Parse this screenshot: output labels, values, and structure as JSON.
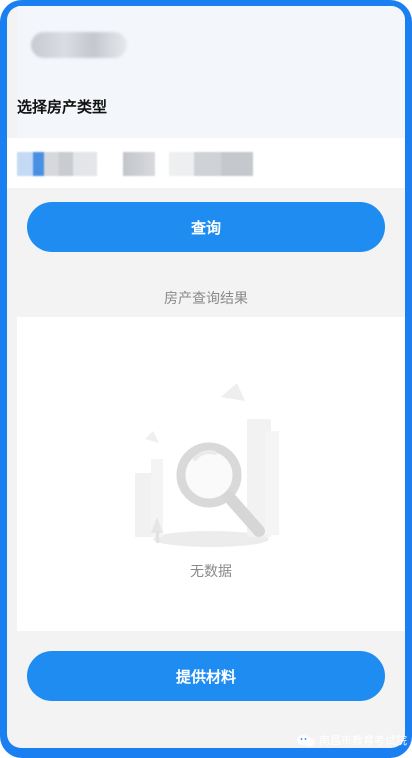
{
  "form": {
    "label": "选择房产类型"
  },
  "buttons": {
    "search": "查询",
    "submit": "提供材料"
  },
  "results": {
    "title": "房产查询结果",
    "empty_text": "无数据"
  },
  "watermark": {
    "text": "南昌市教育考试院",
    "icon": "wechat-icon"
  },
  "colors": {
    "accent": "#1f8cf2",
    "frame": "#1a7ff0"
  }
}
